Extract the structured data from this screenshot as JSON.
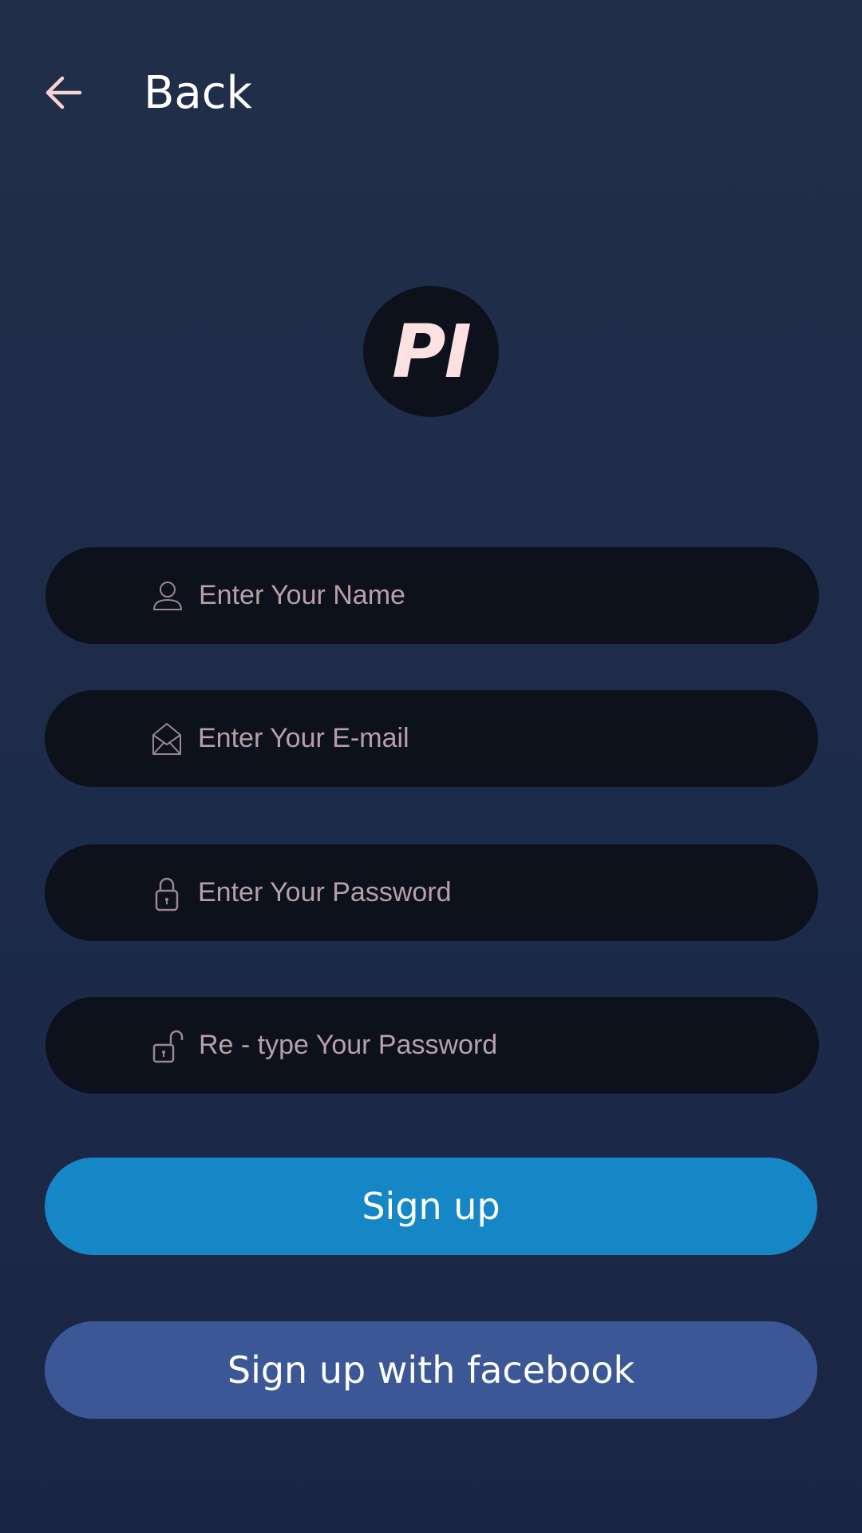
{
  "header": {
    "back_label": "Back",
    "back_icon": "arrow-left-icon"
  },
  "logo": {
    "text": "PI"
  },
  "form": {
    "name": {
      "placeholder": "Enter Your Name",
      "icon": "user-icon"
    },
    "email": {
      "placeholder": "Enter Your E-mail",
      "icon": "envelope-icon"
    },
    "password": {
      "placeholder": "Enter Your Password",
      "icon": "lock-icon"
    },
    "retype_password": {
      "placeholder": "Re - type Your Password",
      "icon": "unlock-icon"
    }
  },
  "buttons": {
    "signup_label": "Sign up",
    "facebook_label": "Sign up with facebook"
  },
  "colors": {
    "background": "#1f2d4a",
    "field_background": "#0c111c",
    "placeholder_text": "#b7a0a7",
    "accent_icon": "#f8d2d0",
    "signup_button": "#1687c6",
    "facebook_button": "#3b5796"
  }
}
